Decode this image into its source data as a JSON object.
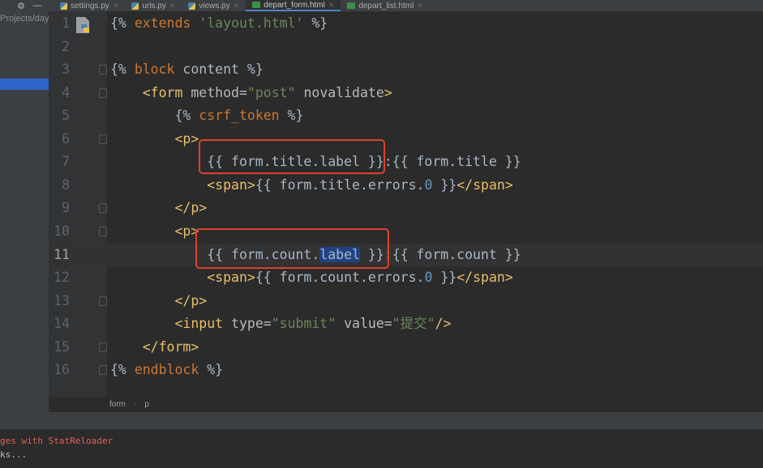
{
  "tabs": [
    {
      "label": "settings.py",
      "icon": "python-file-icon"
    },
    {
      "label": "urls.py",
      "icon": "python-file-icon"
    },
    {
      "label": "views.py",
      "icon": "python-file-icon"
    },
    {
      "label": "depart_form.html",
      "icon": "html-file-icon",
      "active": true
    },
    {
      "label": "depart_list.html",
      "icon": "html-file-icon"
    }
  ],
  "sidebar": {
    "path": "Projects/day"
  },
  "editor": {
    "current_line": 11,
    "lines": [
      [
        [
          "{% ",
          "tpl"
        ],
        [
          "extends",
          "kw"
        ],
        [
          " ",
          "tpl"
        ],
        [
          "'layout.html'",
          "str"
        ],
        [
          " %}",
          "tpl"
        ]
      ],
      [],
      [
        [
          "{% ",
          "tpl"
        ],
        [
          "block",
          "kw"
        ],
        [
          " content %}",
          "tpl"
        ]
      ],
      [
        [
          "    ",
          ""
        ],
        [
          "<form ",
          "tag"
        ],
        [
          "method=",
          "attr"
        ],
        [
          "\"post\"",
          "str"
        ],
        [
          " novalidate",
          "attr"
        ],
        [
          ">",
          "tag"
        ]
      ],
      [
        [
          "        {% ",
          "tpl"
        ],
        [
          "csrf_token",
          "kw"
        ],
        [
          " %}",
          "tpl"
        ]
      ],
      [
        [
          "        ",
          ""
        ],
        [
          "<p>",
          "tag"
        ]
      ],
      [
        [
          "            {{ form.title.label }}:{{ form.title }}",
          "tpl"
        ]
      ],
      [
        [
          "            ",
          ""
        ],
        [
          "<span>",
          "tag"
        ],
        [
          "{{ form.title.errors.",
          "tpl"
        ],
        [
          "0",
          "num"
        ],
        [
          " }}",
          "tpl"
        ],
        [
          "</span>",
          "tag"
        ]
      ],
      [
        [
          "        ",
          ""
        ],
        [
          "</p>",
          "tag"
        ]
      ],
      [
        [
          "        ",
          ""
        ],
        [
          "<p>",
          "tag"
        ]
      ],
      [
        [
          "            {{ form.count.",
          "tpl"
        ],
        [
          "label",
          "sel2"
        ],
        [
          " }}:{{ form.count }}",
          "tpl"
        ]
      ],
      [
        [
          "            ",
          ""
        ],
        [
          "<span>",
          "tag"
        ],
        [
          "{{ form.count.errors.",
          "tpl"
        ],
        [
          "0",
          "num"
        ],
        [
          " }}",
          "tpl"
        ],
        [
          "</span>",
          "tag"
        ]
      ],
      [
        [
          "        ",
          ""
        ],
        [
          "</p>",
          "tag"
        ]
      ],
      [
        [
          "        ",
          ""
        ],
        [
          "<input ",
          "tag"
        ],
        [
          "type=",
          "attr"
        ],
        [
          "\"submit\"",
          "str"
        ],
        [
          " value=",
          "attr"
        ],
        [
          "\"提交\"",
          "str"
        ],
        [
          "/>",
          "tag"
        ]
      ],
      [
        [
          "    ",
          ""
        ],
        [
          "</form>",
          "tag"
        ]
      ],
      [
        [
          "{% ",
          "tpl"
        ],
        [
          "endblock",
          "kw"
        ],
        [
          " %}",
          "tpl"
        ]
      ]
    ],
    "folds": [
      3,
      4,
      6,
      9,
      10,
      13,
      15,
      16
    ]
  },
  "breadcrumb": [
    "form",
    "p"
  ],
  "console": [
    "ges with StatReloader",
    "ks..."
  ],
  "colors": {
    "highlight_box": "#e0412c",
    "selection": "#214283"
  }
}
